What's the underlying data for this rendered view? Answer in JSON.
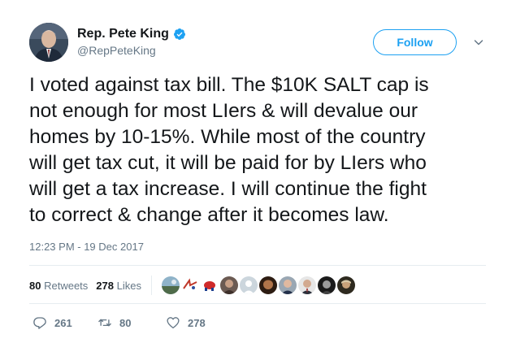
{
  "author": {
    "name": "Rep. Pete King",
    "handle": "@RepPeteKing",
    "verified": true
  },
  "follow_label": "Follow",
  "tweet_text": "I voted against tax bill. The $10K SALT cap is\nnot enough for most LIers & will devalue our\nhomes by 10-15%. While most of the country\nwill get tax cut, it will be paid for by LIers who\nwill get a tax increase. I will continue the fight\nto correct & change after it becomes law.",
  "timestamp": "12:23 PM - 19 Dec 2017",
  "stats": {
    "retweets_count": "80",
    "retweets_label": "Retweets",
    "likes_count": "278",
    "likes_label": "Likes"
  },
  "liker_avatars": [
    "landscape-avatar",
    "flag-avatar",
    "elephant-avatar",
    "portrait-avatar",
    "default-avatar",
    "portrait-avatar",
    "portrait-avatar",
    "portrait-avatar",
    "portrait-avatar",
    "portrait-avatar"
  ],
  "actions": {
    "replies": "261",
    "retweets": "80",
    "likes": "278"
  },
  "colors": {
    "accent": "#1da1f2",
    "text": "#14171a",
    "muted": "#657786",
    "divider": "#e6ecf0"
  }
}
